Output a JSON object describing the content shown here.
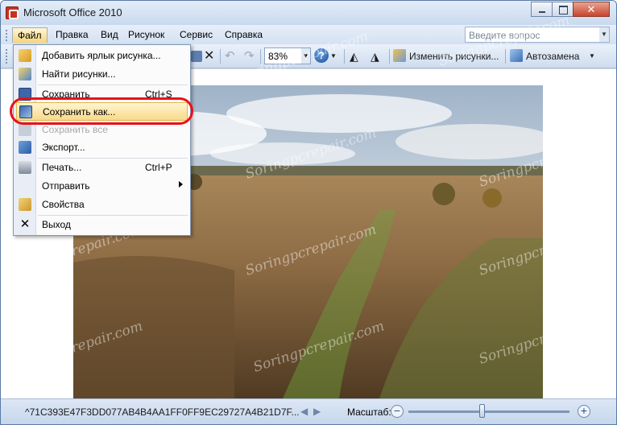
{
  "window": {
    "title": "Microsoft Office 2010"
  },
  "menubar": {
    "items": [
      {
        "label": "Файл",
        "accel": "Ф"
      },
      {
        "label": "Правка"
      },
      {
        "label": "Вид"
      },
      {
        "label": "Рисунок"
      },
      {
        "label": "Сервис"
      },
      {
        "label": "Справка"
      }
    ],
    "help_placeholder": "Введите вопрос"
  },
  "toolbar": {
    "zoom_value": "83%",
    "edit_picture_label": "Изменить рисунки...",
    "autocorrect_label": "Автозамена"
  },
  "file_menu": {
    "items": [
      {
        "label": "Добавить ярлык рисунка...",
        "shortcut": ""
      },
      {
        "label": "Найти рисунки...",
        "shortcut": ""
      },
      {
        "label": "Сохранить",
        "shortcut": "Ctrl+S"
      },
      {
        "label": "Сохранить как...",
        "shortcut": ""
      },
      {
        "label": "Сохранить все",
        "shortcut": ""
      },
      {
        "label": "Экспорт...",
        "shortcut": ""
      },
      {
        "label": "Печать...",
        "shortcut": "Ctrl+P"
      },
      {
        "label": "Отправить",
        "shortcut": ""
      },
      {
        "label": "Свойства",
        "shortcut": ""
      },
      {
        "label": "Выход",
        "shortcut": ""
      }
    ]
  },
  "statusbar": {
    "file_id": "^71C393E47F3DD077AB4B4AA1FF0FF9EC29727A4B21D7F...",
    "zoom_label": "Масштаб:",
    "zoom_minus": "−",
    "zoom_plus": "+"
  },
  "watermark": "Soringpcrepair.com",
  "colors": {
    "highlight_oval": "#e8111b",
    "menu_highlight": "#f8d98a",
    "window_frame": "#cfdced"
  },
  "icons": {
    "app": "office-picture-manager-icon",
    "help": "help-icon"
  }
}
